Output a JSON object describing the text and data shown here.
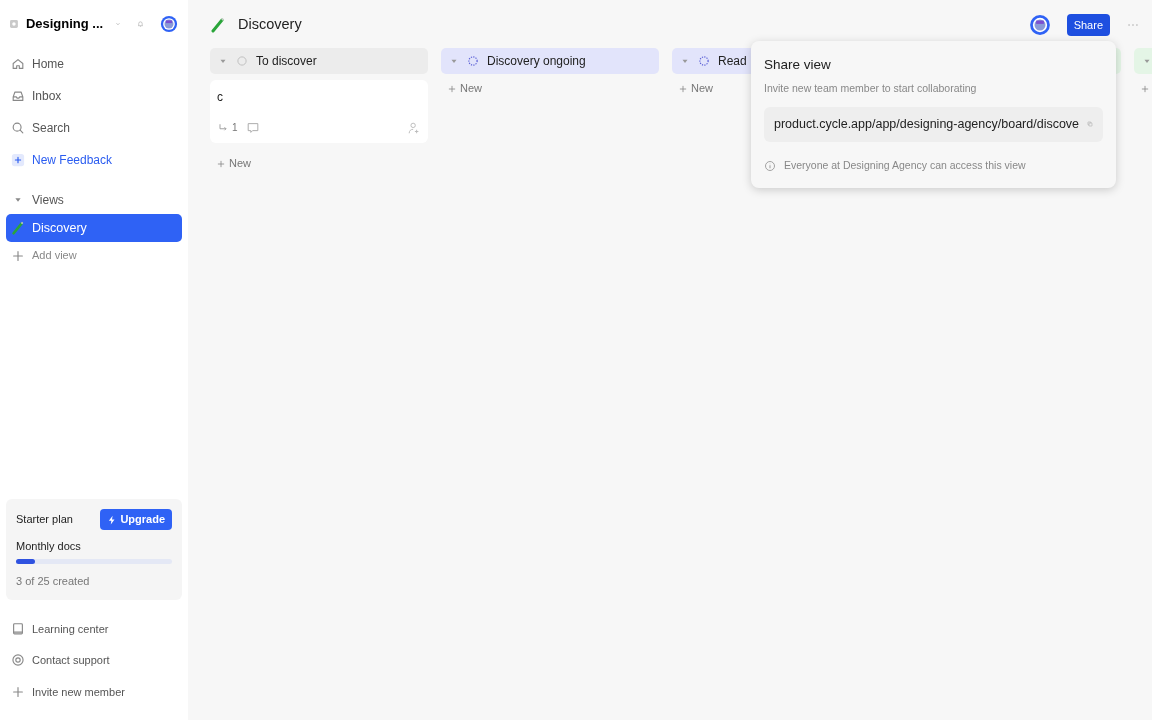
{
  "workspace": {
    "name": "Designing ..."
  },
  "nav": [
    {
      "kind": "home",
      "label": "Home"
    },
    {
      "kind": "inbox",
      "label": "Inbox"
    },
    {
      "kind": "search",
      "label": "Search"
    },
    {
      "kind": "new",
      "label": "New Feedback"
    }
  ],
  "views": {
    "label": "Views",
    "expanded": true,
    "items": [
      {
        "label": "Discovery",
        "selected": true
      }
    ],
    "add_label": "Add view"
  },
  "plan": {
    "name": "Starter plan",
    "upgrade": "Upgrade",
    "meter_label": "Monthly docs",
    "level": 0.12,
    "reading": "3 of 25 created"
  },
  "footer_links": [
    {
      "kind": "book",
      "label": "Learning center"
    },
    {
      "kind": "support",
      "label": "Contact support"
    },
    {
      "kind": "plus",
      "label": "Invite new member"
    }
  ],
  "header": {
    "title": "Discovery",
    "share": "Share"
  },
  "columns": [
    {
      "title": "To discover",
      "color": "#ececec",
      "kind": "empty",
      "expanded": true,
      "cards": [
        {
          "title": "c",
          "links": "1"
        }
      ],
      "new_label": "New"
    },
    {
      "title": "Discovery ongoing",
      "color": "#e2e4fb",
      "kind": "progress",
      "expanded": true,
      "new_label": "New"
    },
    {
      "title": "Read",
      "color": "#e2e4fb",
      "kind": "progress",
      "expanded": true,
      "new_label": "New"
    },
    {
      "color": "#e4f5e6"
    },
    {
      "color": "#e4f5e6",
      "expanded": true,
      "add_button": true
    }
  ],
  "share_popover": {
    "title": "Share view",
    "subtitle": "Invite new team member to start collaborating",
    "url": "product.cycle.app/app/designing-agency/board/discove",
    "note": "Everyone at Designing Agency can access this view"
  }
}
